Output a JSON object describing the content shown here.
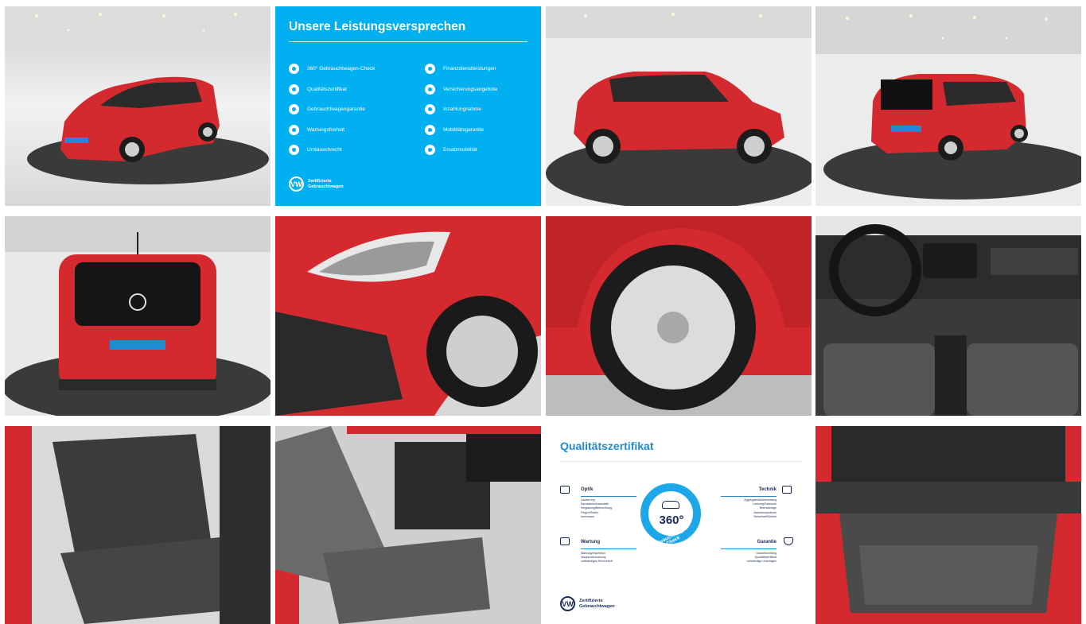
{
  "gallery": {
    "photos": [
      {
        "label": "Front three-quarter exterior view"
      },
      {
        "label": "Side profile exterior view"
      },
      {
        "label": "Rear three-quarter exterior view"
      },
      {
        "label": "Rear exterior view"
      },
      {
        "label": "Headlight detail"
      },
      {
        "label": "Wheel and tyre detail"
      },
      {
        "label": "Dashboard interior"
      },
      {
        "label": "Rear seats interior"
      },
      {
        "label": "Front seats interior"
      },
      {
        "label": "Boot / trunk interior"
      }
    ]
  },
  "promise": {
    "title": "Unsere Leistungsversprechen",
    "left_items": [
      "360° Gebrauchtwagen-Check",
      "Qualitätszertifikat",
      "Gebrauchtwagengarantie",
      "Wartungsfreiheit",
      "Umtauschrecht"
    ],
    "right_items": [
      "Finanzdienstleistungen",
      "Versicherungsangebote",
      "Inzahlungnahme",
      "Mobilitätsgarantie",
      "Ersatzmobilität"
    ],
    "brand_text": "Zertifizierte Gebrauchtwagen",
    "accent_color": "#00b0f0"
  },
  "quality": {
    "title": "Qualitätszertifikat",
    "sections": {
      "optik": {
        "label": "Optik",
        "items": [
          "Lackierung",
          "Karosserie/Anbauteile",
          "Verglasung/Beleuchtung",
          "Felgen/Reifen",
          "Innenraum"
        ]
      },
      "technik": {
        "label": "Technik",
        "items": [
          "Aggregate/Antriebsstrang",
          "Lenkung/Fahrwerk",
          "Bremsanlage",
          "Assistenzsysteme",
          "Sicherheit/Elektrik"
        ]
      },
      "wartung": {
        "label": "Wartung",
        "items": [
          "Wartung/Inspektion",
          "Hauptuntersuchung",
          "vollständiges Serviceheft"
        ]
      },
      "garantie": {
        "label": "Garantie",
        "items": [
          "Garantieumfang",
          "Qualitätszertifikat",
          "vollständige Unterlagen"
        ]
      }
    },
    "badge_number": "360°",
    "badge_arc": "Gebrauchtwagen-Check",
    "brand_text": "Zertifizierte Gebrauchtwagen",
    "accent_color": "#1da7e8"
  },
  "colors": {
    "car_red": "#d42a2f",
    "showroom_grey": "#e8e8e8",
    "turntable": "#3a3a3a"
  }
}
